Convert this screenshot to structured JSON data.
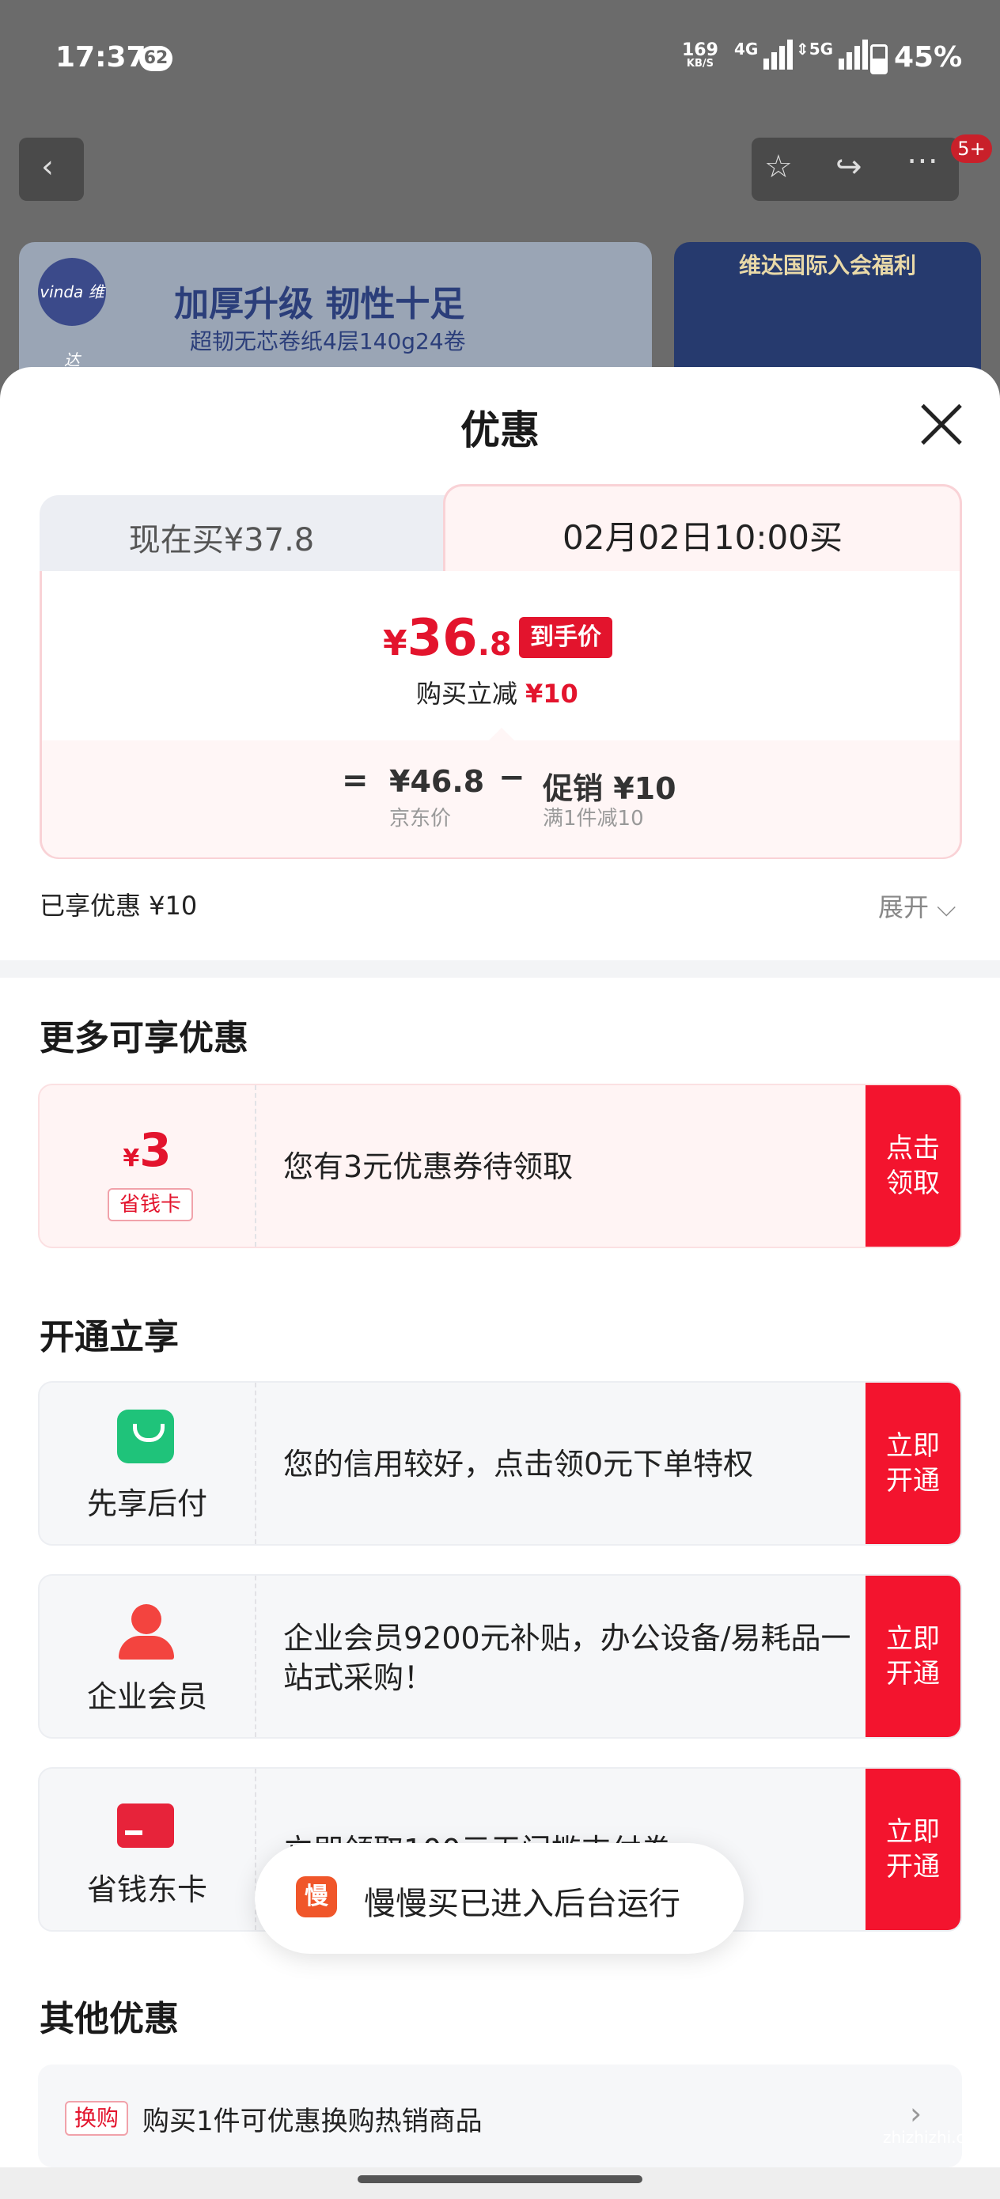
{
  "status_bar": {
    "time": "17:37",
    "notification_count": "62",
    "net_speed_value": "169",
    "net_speed_unit": "KB/S",
    "net_4g": "4G",
    "net_5g": "5G",
    "battery": "45%"
  },
  "nav": {
    "back_icon": "chevron-left-icon",
    "more_badge": "5+"
  },
  "banners": {
    "left_logo": "vinda 维达",
    "left_title": "加厚升级 韧性十足",
    "left_subtitle": "超韧无芯卷纸4层140g24卷",
    "right_title": "维达国际入会福利"
  },
  "sheet": {
    "title": "优惠"
  },
  "price_tabs": {
    "now": "现在买¥37.8",
    "scheduled": "02月02日10:00买"
  },
  "final_price": {
    "currency": "¥",
    "integer": "36",
    "decimal": ".8",
    "tag": "到手价",
    "reduce_label": "购买立减",
    "reduce_value": "¥10"
  },
  "breakdown": {
    "equals": "=",
    "jd_price": "¥46.8",
    "jd_price_label": "京东价",
    "minus": "−",
    "promo": "促销 ¥10",
    "promo_label": "满1件减10"
  },
  "summary": {
    "enjoyed": "已享优惠 ¥10",
    "expand": "展开 ⌵"
  },
  "more_offers": {
    "title": "更多可享优惠",
    "coupon": {
      "currency": "¥",
      "amount": "3",
      "tag": "省钱卡",
      "text": "您有3元优惠券待领取",
      "button": "点击\n领取"
    }
  },
  "open_enjoy": {
    "title": "开通立享",
    "items": [
      {
        "label": "先享后付",
        "text": "您的信用较好，点击领0元下单特权",
        "button": "立即\n开通"
      },
      {
        "label": "企业会员",
        "text": "企业会员9200元补贴，办公设备/易耗品一站式采购！",
        "button": "立即\n开通"
      },
      {
        "label": "省钱东卡",
        "text": "立即领取100元无门槛支付券",
        "button": "立即\n开通"
      }
    ]
  },
  "toast": {
    "icon_char": "慢",
    "text": "慢慢买已进入后台运行"
  },
  "other_offers": {
    "title": "其他优惠",
    "tag": "换购",
    "text": "购买1件可优惠换购热销商品",
    "chevron": "›"
  },
  "watermark": "zhizhizhi.com",
  "colors": {
    "accent_red": "#e3142d",
    "button_red": "#f3142e",
    "green_icon": "#1fc37a"
  }
}
